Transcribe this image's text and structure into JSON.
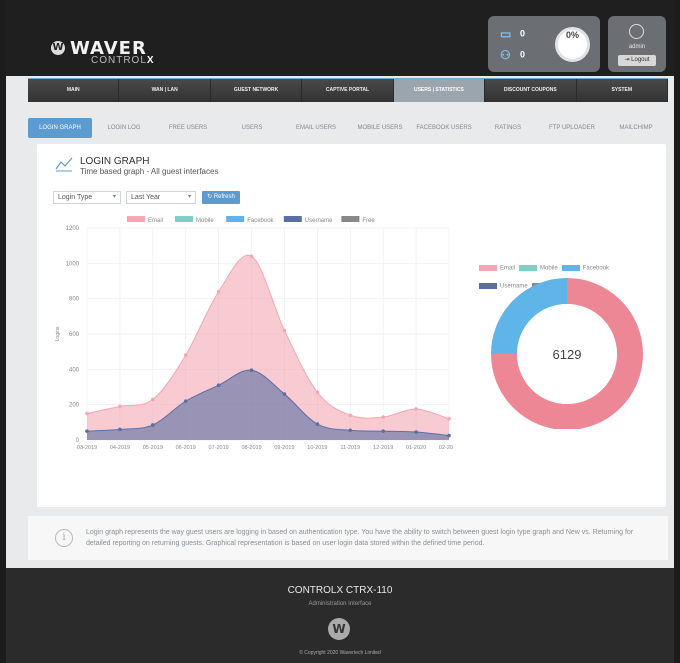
{
  "brand": {
    "mark": "W",
    "name": "WAVER",
    "sub_a": "CONTROL",
    "sub_b": "X"
  },
  "stats": {
    "devices": "0",
    "users": "0",
    "percent": "0%"
  },
  "user": {
    "name": "admin",
    "logout": "Logout"
  },
  "nav": [
    "MAIN",
    "WAN | LAN",
    "GUEST NETWORK",
    "CAPTIVE PORTAL",
    "USERS | STATISTICS",
    "DISCOUNT COUPONS",
    "SYSTEM"
  ],
  "tabs": [
    "LOGIN GRAPH",
    "LOGIN LOG",
    "FREE USERS",
    "USERS",
    "EMAIL USERS",
    "MOBILE USERS",
    "FACEBOOK USERS",
    "RATINGS",
    "FTP UPLOADER",
    "MAILCHIMP"
  ],
  "card": {
    "title": "LOGIN GRAPH",
    "subtitle": "Time based graph - All guest interfaces"
  },
  "filters": {
    "type": "Login Type",
    "period": "Last Year",
    "refresh": "Refresh"
  },
  "colors": {
    "email": "#f3a7b3",
    "mobile": "#7fcfc5",
    "facebook": "#5fb5e8",
    "username": "#5a6fa3",
    "free": "#888888",
    "accent": "#5b9bd0"
  },
  "chart_data": {
    "type": "area",
    "ylabel": "Logins",
    "ylim": [
      0,
      1200
    ],
    "yticks": [
      0,
      200,
      400,
      600,
      800,
      1000,
      1200
    ],
    "categories": [
      "03-2019",
      "04-2019",
      "05-2019",
      "06-2019",
      "07-2019",
      "08-2019",
      "09-2019",
      "10-2019",
      "11-2019",
      "12-2019",
      "01-2020",
      "02-2020"
    ],
    "series": [
      {
        "name": "Email",
        "values": [
          150,
          190,
          230,
          480,
          840,
          1040,
          620,
          270,
          140,
          130,
          175,
          120
        ]
      },
      {
        "name": "Mobile",
        "values": [
          0,
          0,
          0,
          0,
          0,
          0,
          0,
          0,
          0,
          0,
          0,
          0
        ]
      },
      {
        "name": "Facebook",
        "values": [
          0,
          0,
          0,
          0,
          0,
          0,
          0,
          0,
          0,
          0,
          0,
          0
        ]
      },
      {
        "name": "Username",
        "values": [
          50,
          60,
          85,
          220,
          310,
          395,
          260,
          90,
          55,
          50,
          45,
          25
        ]
      },
      {
        "name": "Free",
        "values": [
          0,
          0,
          0,
          0,
          0,
          0,
          0,
          0,
          0,
          0,
          0,
          0
        ]
      }
    ]
  },
  "pie": {
    "total": "6129",
    "legend": [
      "Email",
      "Mobile",
      "Facebook",
      "Username",
      "Free"
    ],
    "slices": [
      {
        "name": "Email",
        "value": 0.75
      },
      {
        "name": "Facebook",
        "value": 0.25
      }
    ]
  },
  "info": "Login graph represents the way guest users are logging in based on authentication type. You have the ability to switch between guest login type graph and New vs. Returning for detailed reporting on returning guests. Graphical representation is based on user login data stored within the defined time period.",
  "footer": {
    "title": "CONTROLX CTRX-110",
    "sub": "Administration Interface",
    "mark": "W",
    "copy": "© Copyright 2020 Wavertech Limited"
  }
}
